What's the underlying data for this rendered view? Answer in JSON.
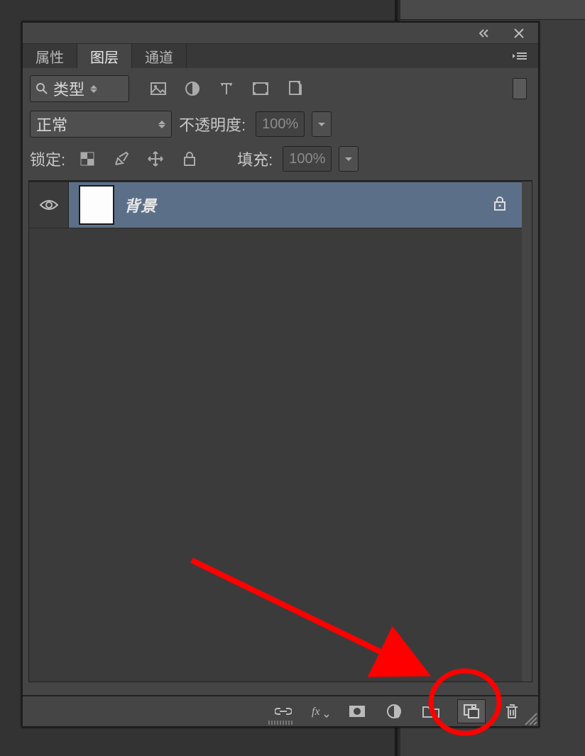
{
  "tabs": {
    "properties": "属性",
    "layers": "图层",
    "channels": "通道"
  },
  "filter": {
    "kind_label": "类型"
  },
  "blend": {
    "mode_label": "正常",
    "opacity_label": "不透明度:",
    "opacity_value": "100%"
  },
  "lock": {
    "label": "锁定:",
    "fill_label": "填充:",
    "fill_value": "100%"
  },
  "layers": [
    {
      "name": "背景",
      "locked": true
    }
  ],
  "icons": {
    "search": "search-icon",
    "image": "image-filter-icon",
    "adjust": "adjustment-filter-icon",
    "text": "text-filter-icon",
    "shape": "shape-filter-icon",
    "smart": "smartobject-filter-icon"
  }
}
